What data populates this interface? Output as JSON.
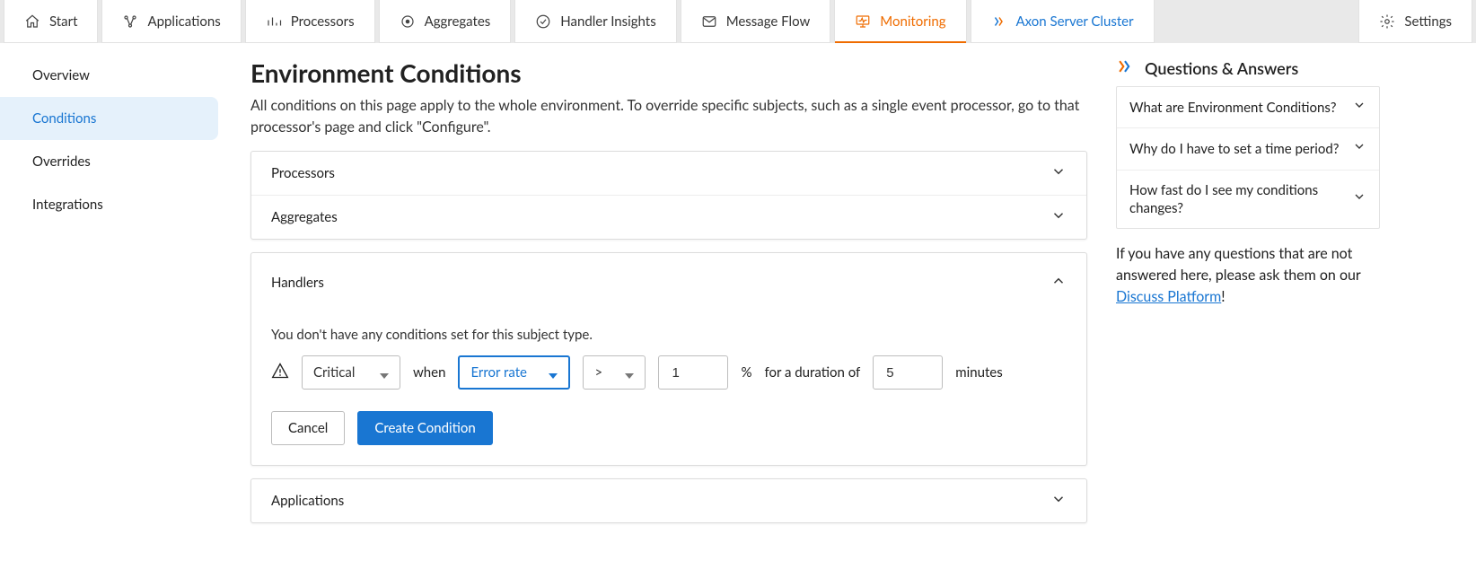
{
  "topnav": [
    {
      "id": "start",
      "label": "Start"
    },
    {
      "id": "applications",
      "label": "Applications"
    },
    {
      "id": "processors",
      "label": "Processors"
    },
    {
      "id": "aggregates",
      "label": "Aggregates"
    },
    {
      "id": "handler-insights",
      "label": "Handler Insights"
    },
    {
      "id": "message-flow",
      "label": "Message Flow"
    },
    {
      "id": "monitoring",
      "label": "Monitoring",
      "active": true
    },
    {
      "id": "axon-server-cluster",
      "label": "Axon Server Cluster",
      "cluster": true
    }
  ],
  "settings_label": "Settings",
  "sidebar": [
    {
      "id": "overview",
      "label": "Overview"
    },
    {
      "id": "conditions",
      "label": "Conditions",
      "active": true
    },
    {
      "id": "overrides",
      "label": "Overrides"
    },
    {
      "id": "integrations",
      "label": "Integrations"
    }
  ],
  "page": {
    "title": "Environment Conditions",
    "lead": "All conditions on this page apply to the whole environment. To override specific subjects, such as a single event processor, go to that processor's page and click \"Configure\"."
  },
  "sections": {
    "processors": "Processors",
    "aggregates": "Aggregates",
    "handlers": "Handlers",
    "applications": "Applications"
  },
  "handlers_panel": {
    "empty": "You don't have any conditions set for this subject type.",
    "severity": "Critical",
    "when": "when",
    "metric": "Error rate",
    "operator": ">",
    "threshold": "1",
    "pct": "%",
    "duration_label": "for a duration of",
    "duration": "5",
    "minutes": "minutes",
    "cancel": "Cancel",
    "create": "Create Condition"
  },
  "rail": {
    "title": "Questions & Answers",
    "questions": [
      "What are Environment Conditions?",
      "Why do I have to set a time period?",
      "How fast do I see my conditions changes?"
    ],
    "note_pre": "If you have any questions that are not answered here, please ask them on our ",
    "note_link": "Discuss Platform",
    "note_post": "!"
  }
}
